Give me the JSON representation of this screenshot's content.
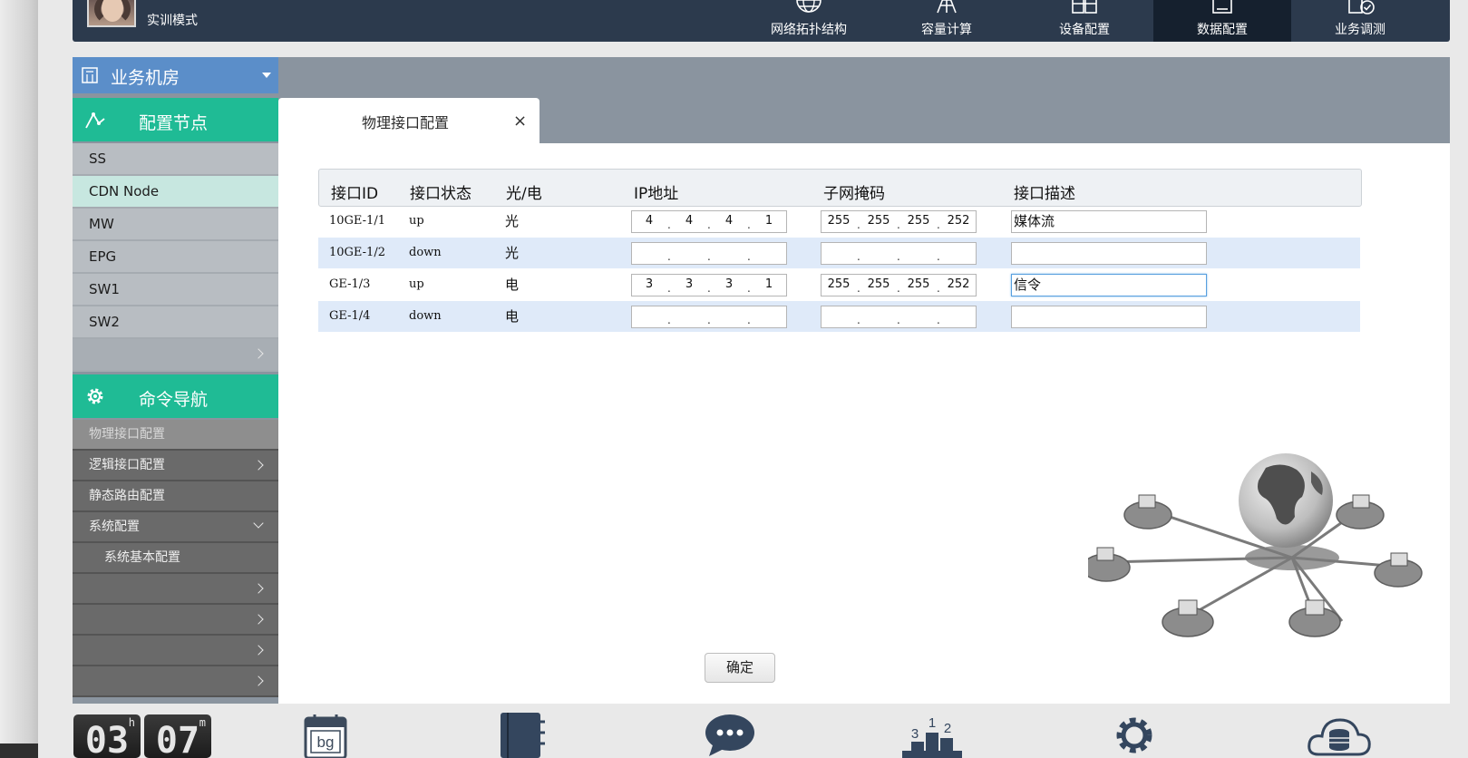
{
  "header": {
    "mode_label": "实训模式",
    "nav": [
      {
        "label": "网络拓扑结构",
        "icon": "globe-icon",
        "active": false
      },
      {
        "label": "容量计算",
        "icon": "tower-icon",
        "active": false
      },
      {
        "label": "设备配置",
        "icon": "grid-icon",
        "active": false
      },
      {
        "label": "数据配置",
        "icon": "document-icon",
        "active": true
      },
      {
        "label": "业务调测",
        "icon": "check-document-icon",
        "active": false
      }
    ]
  },
  "sidebar": {
    "room_label": "业务机房",
    "config_nodes_title": "配置节点",
    "nodes": [
      "SS",
      "CDN Node",
      "MW",
      "EPG",
      "SW1",
      "SW2"
    ],
    "active_node": "CDN Node",
    "command_nav_title": "命令导航",
    "commands": [
      "物理接口配置",
      "逻辑接口配置",
      "静态路由配置",
      "系统配置",
      "系统基本配置"
    ]
  },
  "tab": {
    "label": "物理接口配置",
    "close": "×"
  },
  "table": {
    "headers": [
      "接口ID",
      "接口状态",
      "光/电",
      "IP地址",
      "子网掩码",
      "接口描述"
    ],
    "rows": [
      {
        "id": "10GE-1/1",
        "status": "up",
        "medium": "光",
        "ip": [
          "4",
          "4",
          "4",
          "1"
        ],
        "mask": [
          "255",
          "255",
          "255",
          "252"
        ],
        "desc": "媒体流"
      },
      {
        "id": "10GE-1/2",
        "status": "down",
        "medium": "光",
        "ip": [
          "",
          "",
          "",
          ""
        ],
        "mask": [
          "",
          "",
          "",
          ""
        ],
        "desc": ""
      },
      {
        "id": "GE-1/3",
        "status": "up",
        "medium": "电",
        "ip": [
          "3",
          "3",
          "3",
          "1"
        ],
        "mask": [
          "255",
          "255",
          "255",
          "252"
        ],
        "desc": "信令"
      },
      {
        "id": "GE-1/4",
        "status": "down",
        "medium": "电",
        "ip": [
          "",
          "",
          "",
          ""
        ],
        "mask": [
          "",
          "",
          "",
          ""
        ],
        "desc": ""
      }
    ]
  },
  "confirm_label": "确定",
  "dock": {
    "clock": {
      "hours": "03",
      "minutes": "07",
      "hours_unit": "h",
      "minutes_unit": "m"
    },
    "calendar_text": "bg",
    "ranking_digits": [
      "3",
      "1",
      "2"
    ]
  },
  "colors": {
    "topbar": "#2c3a4d",
    "accent_green": "#1fbb95",
    "accent_blue": "#5b8ec9"
  }
}
